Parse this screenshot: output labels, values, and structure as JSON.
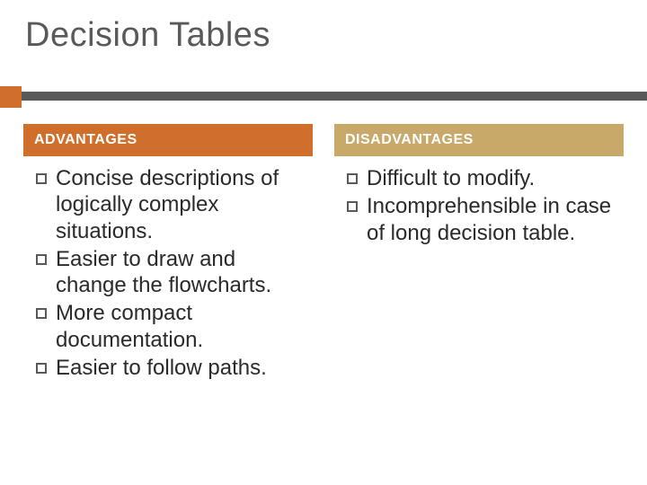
{
  "title": "Decision Tables",
  "columns": {
    "advantages": {
      "header": "ADVANTAGES",
      "items": [
        "Concise descriptions of logically complex situations.",
        "Easier to draw and change the flowcharts.",
        "More compact documentation.",
        "Easier to follow paths."
      ]
    },
    "disadvantages": {
      "header": "DISADVANTAGES",
      "items": [
        "Difficult to modify.",
        "Incomprehensible in case of long decision table."
      ]
    }
  }
}
